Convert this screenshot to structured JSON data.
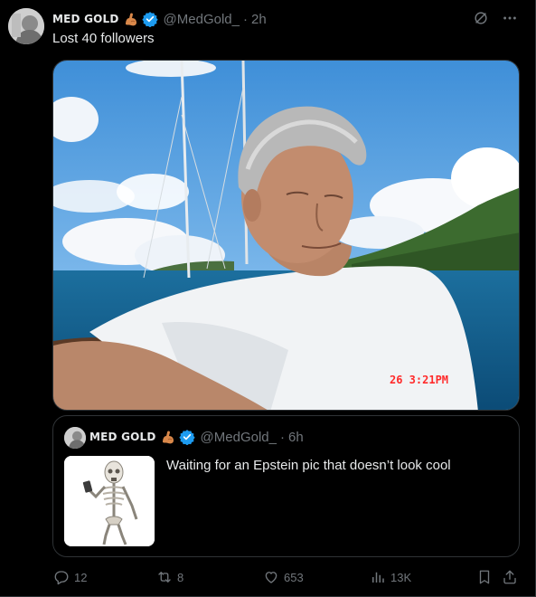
{
  "tweet": {
    "display_name": "MED GOLD",
    "handle": "@MedGold_",
    "dot": "·",
    "time": "2h",
    "text": "Lost 40 followers",
    "photo_timestamp": "26  3:21PM"
  },
  "quoted": {
    "display_name": "MED GOLD",
    "handle": "@MedGold_",
    "dot": "·",
    "time": "6h",
    "text": "Waiting for an Epstein pic that doesn’t look cool"
  },
  "actions": {
    "replies": "12",
    "retweets": "8",
    "likes": "653",
    "views": "13K"
  },
  "colors": {
    "background": "#000000",
    "text": "#e7e9ea",
    "muted": "#71767b",
    "verified": "#1d9bf0",
    "border": "#2f3336"
  },
  "icons": [
    "grok-icon",
    "more-icon",
    "verified-icon",
    "flexed-arm-emoji",
    "reply-icon",
    "retweet-icon",
    "like-icon",
    "views-icon",
    "bookmark-icon",
    "share-icon"
  ]
}
